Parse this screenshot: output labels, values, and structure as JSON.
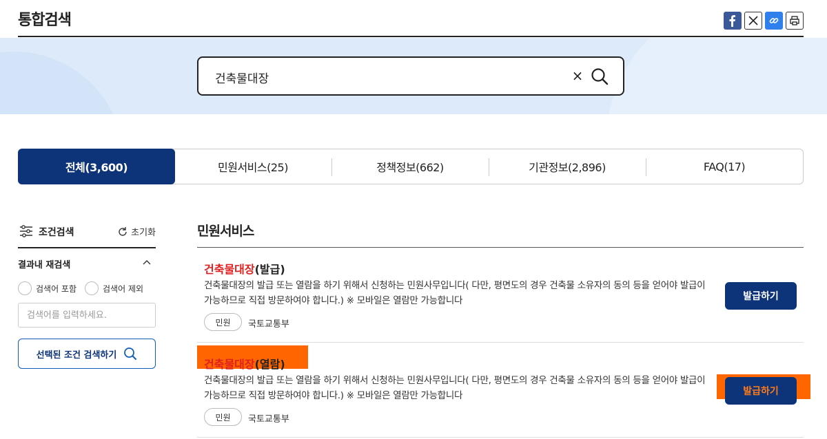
{
  "header": {
    "title": "통합검색"
  },
  "share": {
    "facebook_icon": "facebook-icon",
    "x_icon": "x-icon",
    "link_icon": "link-icon",
    "print_icon": "print-icon"
  },
  "search": {
    "value": "건축물대장",
    "clear_label": "×"
  },
  "tabs": [
    {
      "label": "전체(3,600)",
      "active": true
    },
    {
      "label": "민원서비스(25)",
      "active": false
    },
    {
      "label": "정책정보(662)",
      "active": false
    },
    {
      "label": "기관정보(2,896)",
      "active": false
    },
    {
      "label": "FAQ(17)",
      "active": false
    }
  ],
  "filter": {
    "title": "조건검색",
    "reset_label": "초기화",
    "refine_title": "결과내 재검색",
    "include_label": "검색어 포함",
    "exclude_label": "검색어 제외",
    "placeholder": "검색어를 입력하세요.",
    "apply_label": "선택된 조건 검색하기"
  },
  "results": {
    "section_title": "민원서비스",
    "items": [
      {
        "title_highlight": "건축물대장",
        "title_rest": "(발급)",
        "description": "건축물대장의 발급 또는 열람을 하기 위해서 신청하는 민원사무입니다( 다만, 평면도의 경우 건축물 소유자의 동의 등을 얻어야 발급이 가능하므로 직접 방문하여야 합니다.) ※ 모바일은 열람만 가능합니다",
        "tag": "민원",
        "org": "국토교통부",
        "button": "발급하기"
      },
      {
        "title_highlight": "건축물대장",
        "title_rest": "(열람)",
        "description": "건축물대장의 발급 또는 열람을 하기 위해서 신청하는 민원사무입니다( 다만, 평면도의 경우 건축물 소유자의 동의 등을 얻어야 발급이 가능하므로 직접 방문하여야 합니다.) ※ 모바일은 열람만 가능합니다",
        "tag": "민원",
        "org": "국토교통부",
        "button": "발급하기"
      }
    ]
  },
  "colors": {
    "primary": "#0d3478",
    "highlight": "#e02020",
    "band": "#ddeafa",
    "overlay": "#ff6600"
  }
}
